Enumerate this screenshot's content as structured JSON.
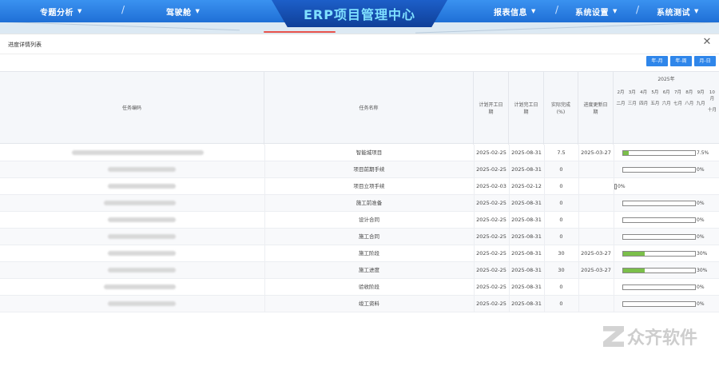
{
  "nav": {
    "left": [
      "专题分析",
      "驾驶舱"
    ],
    "title": "ERP项目管理中心",
    "right": [
      "报表信息",
      "系统设置",
      "系统测试"
    ]
  },
  "dialog": {
    "title": "进度详情列表",
    "view_buttons": [
      "年-月",
      "年-周",
      "月-日"
    ]
  },
  "table": {
    "headers": {
      "code": "任务编码",
      "name": "任务名称",
      "plan_start": "计划开工日期",
      "plan_end": "计划完工日期",
      "actual": "实际完成(%)",
      "updated": "进度更新日期",
      "year": "2025年"
    },
    "months": [
      {
        "top": "2月",
        "sub": "二月"
      },
      {
        "top": "3月",
        "sub": "三月"
      },
      {
        "top": "4月",
        "sub": "四月"
      },
      {
        "top": "5月",
        "sub": "五月"
      },
      {
        "top": "6月",
        "sub": "六月"
      },
      {
        "top": "7月",
        "sub": "七月"
      },
      {
        "top": "8月",
        "sub": "八月"
      },
      {
        "top": "9月",
        "sub": "九月"
      },
      {
        "top": "10月",
        "sub": "十月"
      }
    ],
    "rows": [
      {
        "name": "智能城项目",
        "plan_start": "2025-02-25",
        "plan_end": "2025-08-31",
        "actual": "7.5",
        "updated": "2025-03-27",
        "progress": 7.5,
        "progress_label": "7.5%"
      },
      {
        "name": "项目前期手续",
        "plan_start": "2025-02-25",
        "plan_end": "2025-08-31",
        "actual": "0",
        "updated": "",
        "progress": 0,
        "progress_label": "0%"
      },
      {
        "name": "项目立项手续",
        "plan_start": "2025-02-03",
        "plan_end": "2025-02-12",
        "actual": "0",
        "updated": "",
        "progress": 0,
        "progress_label": "0%"
      },
      {
        "name": "施工前准备",
        "plan_start": "2025-02-25",
        "plan_end": "2025-08-31",
        "actual": "0",
        "updated": "",
        "progress": 0,
        "progress_label": "0%"
      },
      {
        "name": "设计合同",
        "plan_start": "2025-02-25",
        "plan_end": "2025-08-31",
        "actual": "0",
        "updated": "",
        "progress": 0,
        "progress_label": "0%"
      },
      {
        "name": "施工合同",
        "plan_start": "2025-02-25",
        "plan_end": "2025-08-31",
        "actual": "0",
        "updated": "",
        "progress": 0,
        "progress_label": "0%"
      },
      {
        "name": "施工阶段",
        "plan_start": "2025-02-25",
        "plan_end": "2025-08-31",
        "actual": "30",
        "updated": "2025-03-27",
        "progress": 30,
        "progress_label": "30%"
      },
      {
        "name": "施工进度",
        "plan_start": "2025-02-25",
        "plan_end": "2025-08-31",
        "actual": "30",
        "updated": "2025-03-27",
        "progress": 30,
        "progress_label": "30%"
      },
      {
        "name": "验收阶段",
        "plan_start": "2025-02-25",
        "plan_end": "2025-08-31",
        "actual": "0",
        "updated": "",
        "progress": 0,
        "progress_label": "0%"
      },
      {
        "name": "竣工资料",
        "plan_start": "2025-02-25",
        "plan_end": "2025-08-31",
        "actual": "0",
        "updated": "",
        "progress": 0,
        "progress_label": "0%"
      }
    ]
  },
  "watermark": "众齐软件",
  "colors": {
    "nav": "#2a80e6",
    "progress": "#7bbf4a",
    "button": "#2f86ea"
  }
}
